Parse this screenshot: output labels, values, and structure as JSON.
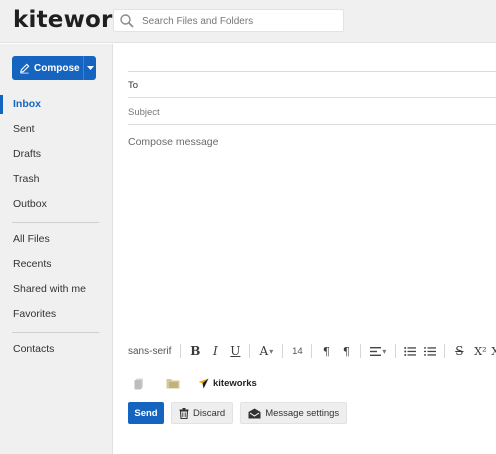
{
  "app": {
    "logo": "kiteworks"
  },
  "search": {
    "placeholder": "Search Files and Folders",
    "icon": "search-icon"
  },
  "sidebar": {
    "compose_label": "Compose",
    "nav_primary": [
      {
        "label": "Inbox",
        "active": true
      },
      {
        "label": "Sent"
      },
      {
        "label": "Drafts"
      },
      {
        "label": "Trash"
      },
      {
        "label": "Outbox"
      }
    ],
    "nav_files": [
      {
        "label": "All Files"
      },
      {
        "label": "Recents"
      },
      {
        "label": "Shared with me"
      },
      {
        "label": "Favorites"
      }
    ],
    "nav_other": [
      {
        "label": "Contacts"
      }
    ]
  },
  "compose": {
    "to_label": "To",
    "subject_label": "Subject",
    "body_placeholder": "Compose message"
  },
  "toolbar": {
    "font_family": "sans-serif",
    "bold": "B",
    "italic": "I",
    "underline": "U",
    "font_color": "A",
    "font_size": "14",
    "ltr": "¶",
    "rtl": "¶",
    "strikethrough": "S",
    "superscript": "X²",
    "subscript": "X"
  },
  "attach": {
    "kiteworks_label": "kiteworks"
  },
  "actions": {
    "send": "Send",
    "discard": "Discard",
    "message_settings": "Message settings"
  },
  "colors": {
    "accent": "#1565c0",
    "sidebar_bg": "#f0f0f0"
  }
}
